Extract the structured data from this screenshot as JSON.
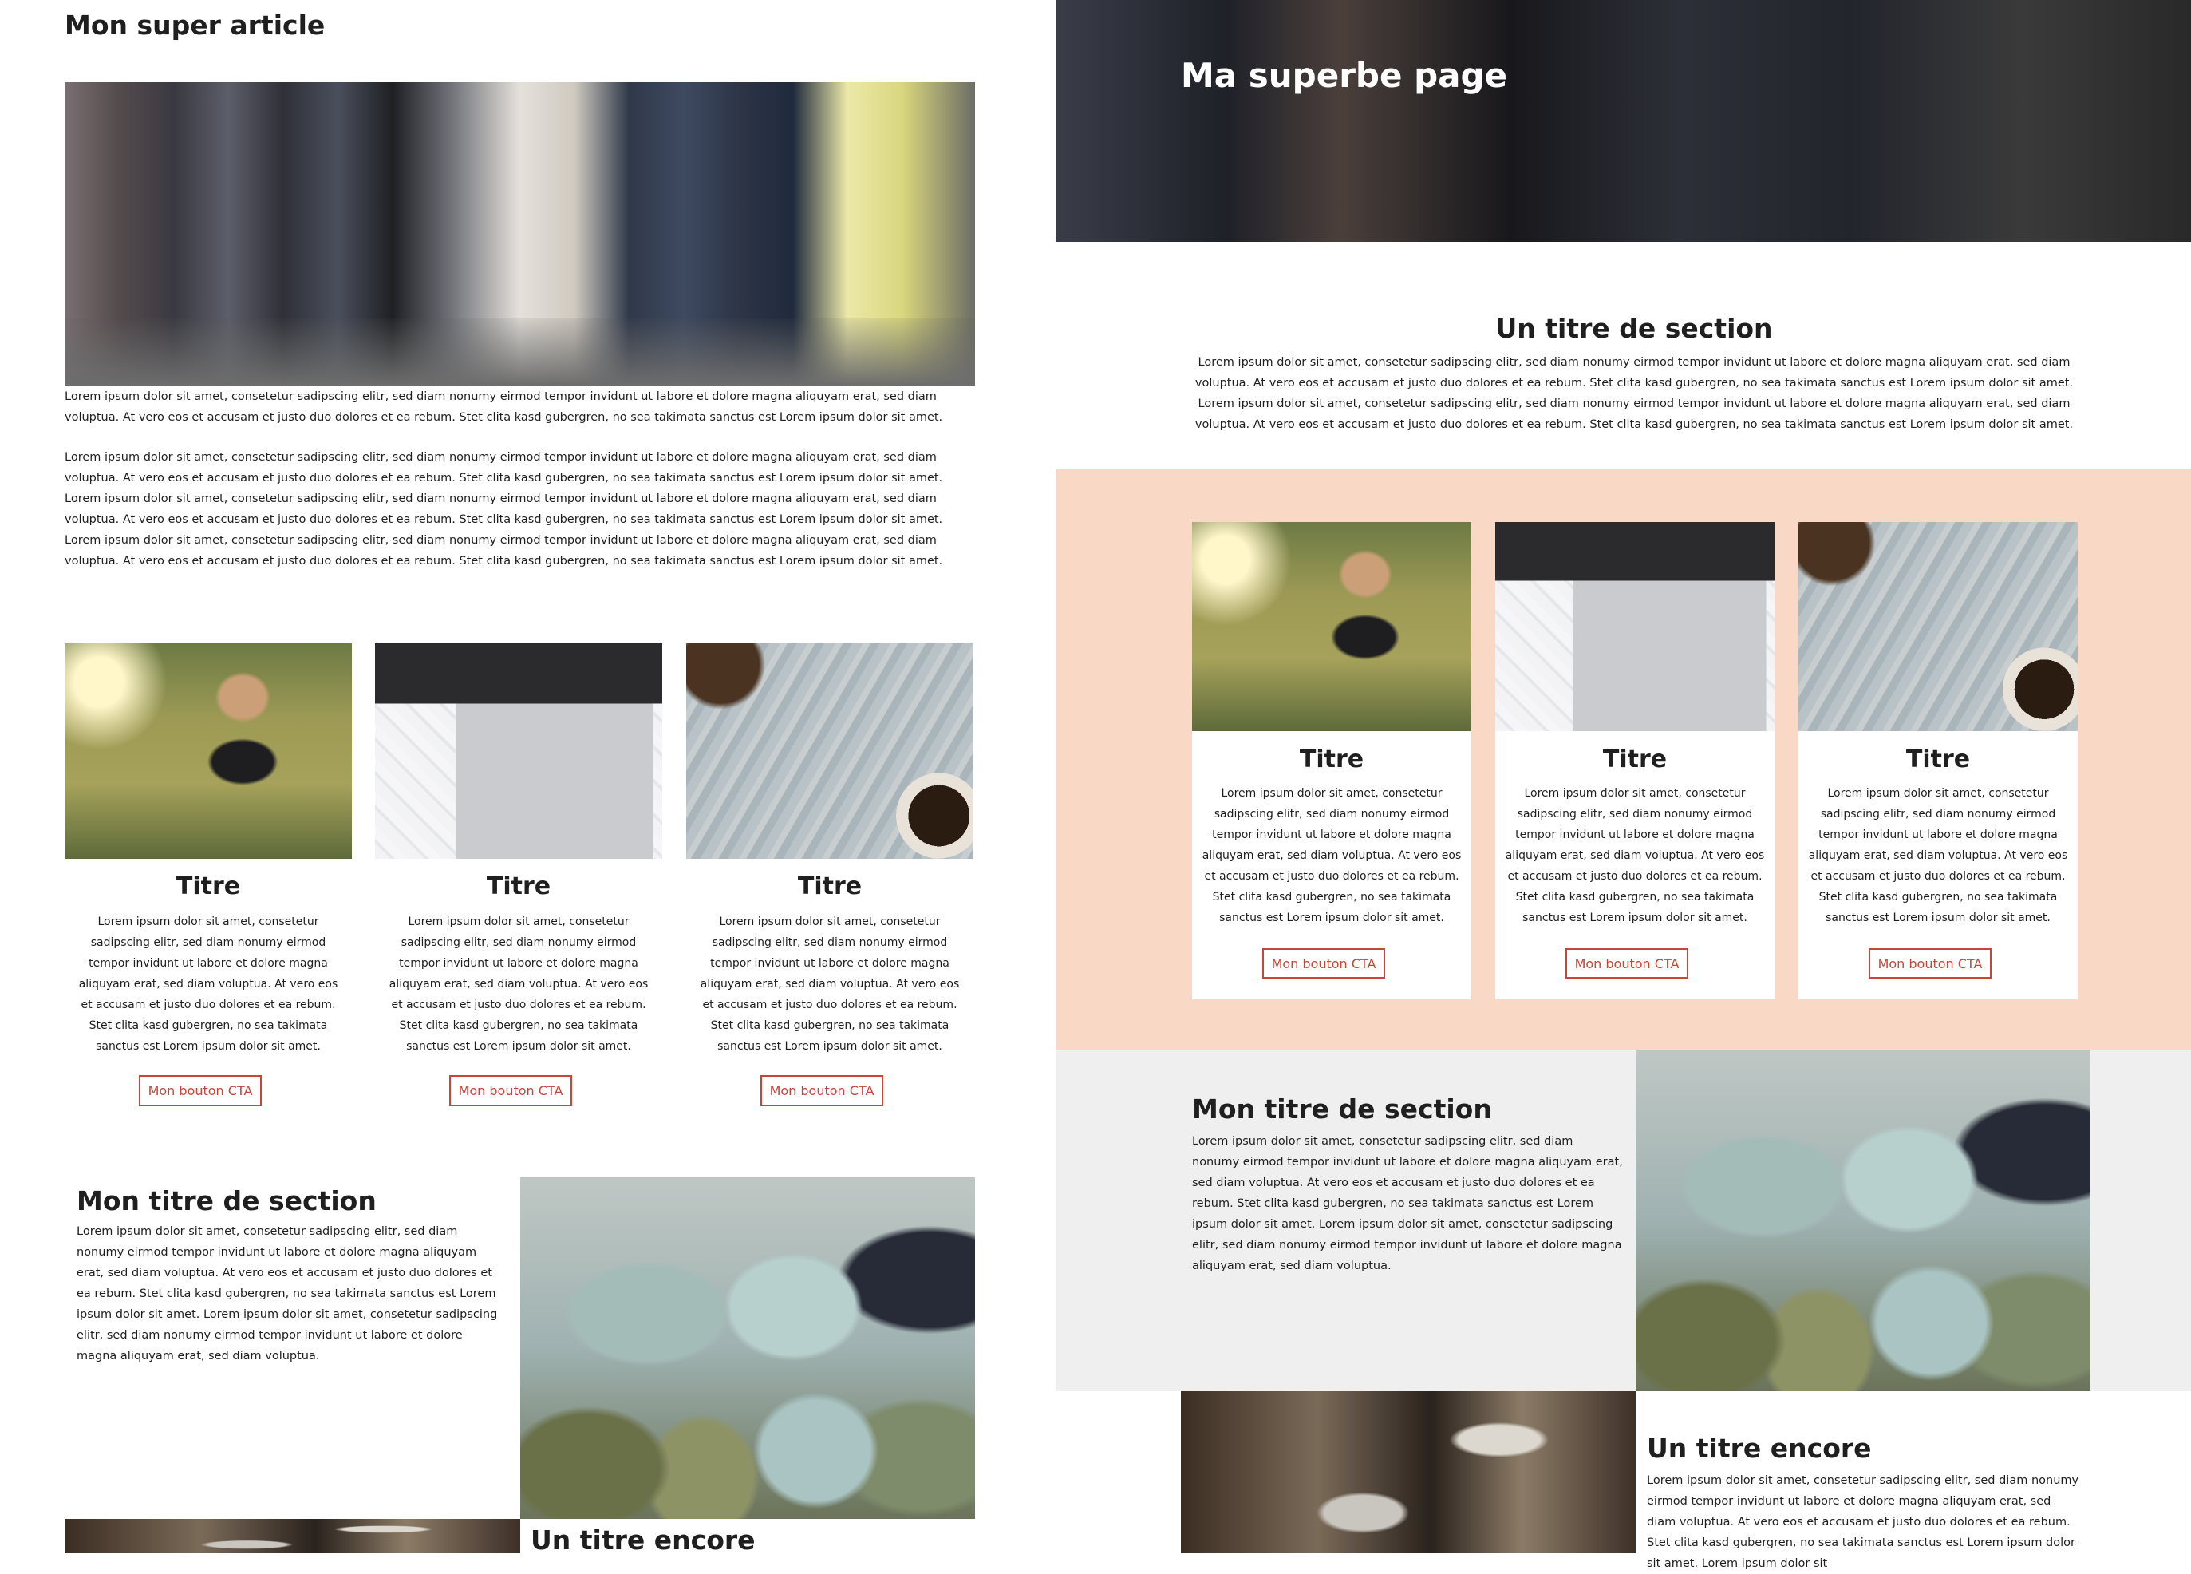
{
  "left": {
    "article_title": "Mon super article",
    "intro_short": "Lorem ipsum dolor sit amet, consetetur sadipscing elitr, sed diam nonumy eirmod tempor invidunt ut labore et dolore magna aliquyam erat, sed diam voluptua. At vero eos et accusam et justo duo dolores et ea rebum. Stet clita kasd gubergren, no sea takimata sanctus est Lorem ipsum dolor sit amet.",
    "intro_long": "Lorem ipsum dolor sit amet, consetetur sadipscing elitr, sed diam nonumy eirmod tempor invidunt ut labore et dolore magna aliquyam erat, sed diam voluptua. At vero eos et accusam et justo duo dolores et ea rebum. Stet clita kasd gubergren, no sea takimata sanctus est Lorem ipsum dolor sit amet. Lorem ipsum dolor sit amet, consetetur sadipscing elitr, sed diam nonumy eirmod tempor invidunt ut labore et dolore magna aliquyam erat, sed diam voluptua. At vero eos et accusam et justo duo dolores et ea rebum. Stet clita kasd gubergren, no sea takimata sanctus est Lorem ipsum dolor sit amet. Lorem ipsum dolor sit amet, consetetur sadipscing elitr, sed diam nonumy eirmod tempor invidunt ut labore et dolore magna aliquyam erat, sed diam voluptua. At vero eos et accusam et justo duo dolores et ea rebum. Stet clita kasd gubergren, no sea takimata sanctus est Lorem ipsum dolor sit amet.",
    "cards": [
      {
        "title": "Titre",
        "text": "Lorem ipsum dolor sit amet, consetetur sadipscing elitr, sed diam nonumy eirmod tempor invidunt ut labore et dolore magna aliquyam erat, sed diam voluptua. At vero eos et accusam et justo duo dolores et ea rebum. Stet clita kasd gubergren, no sea takimata sanctus est Lorem ipsum dolor sit amet.",
        "cta": "Mon bouton CTA"
      },
      {
        "title": "Titre",
        "text": "Lorem ipsum dolor sit amet, consetetur sadipscing elitr, sed diam nonumy eirmod tempor invidunt ut labore et dolore magna aliquyam erat, sed diam voluptua. At vero eos et accusam et justo duo dolores et ea rebum. Stet clita kasd gubergren, no sea takimata sanctus est Lorem ipsum dolor sit amet.",
        "cta": "Mon bouton CTA"
      },
      {
        "title": "Titre",
        "text": "Lorem ipsum dolor sit amet, consetetur sadipscing elitr, sed diam nonumy eirmod tempor invidunt ut labore et dolore magna aliquyam erat, sed diam voluptua. At vero eos et accusam et justo duo dolores et ea rebum. Stet clita kasd gubergren, no sea takimata sanctus est Lorem ipsum dolor sit amet.",
        "cta": "Mon bouton CTA"
      }
    ],
    "section_title": "Mon titre de section",
    "section_text": "Lorem ipsum dolor sit amet, consetetur sadipscing elitr, sed diam nonumy eirmod tempor invidunt ut labore et dolore magna aliquyam erat, sed diam voluptua. At vero eos et accusam et justo duo dolores et ea rebum. Stet clita kasd gubergren, no sea takimata sanctus est Lorem ipsum dolor sit amet. Lorem ipsum dolor sit amet, consetetur sadipscing elitr, sed diam nonumy eirmod tempor invidunt ut labore et dolore magna aliquyam erat, sed diam voluptua.",
    "title_encore": "Un titre encore"
  },
  "right": {
    "hero_title": "Ma superbe page",
    "section_heading": "Un titre de section",
    "section_intro": "Lorem ipsum dolor sit amet, consetetur sadipscing elitr, sed diam nonumy eirmod tempor invidunt ut labore et dolore magna aliquyam erat, sed diam voluptua. At vero eos et accusam et justo duo dolores et ea rebum. Stet clita kasd gubergren, no sea takimata sanctus est Lorem ipsum dolor sit amet. Lorem ipsum dolor sit amet, consetetur sadipscing elitr, sed diam nonumy eirmod tempor invidunt ut labore et dolore magna aliquyam erat, sed diam voluptua. At vero eos et accusam et justo duo dolores et ea rebum. Stet clita kasd gubergren, no sea takimata sanctus est Lorem ipsum dolor sit amet.",
    "cards": [
      {
        "title": "Titre",
        "text": "Lorem ipsum dolor sit amet, consetetur sadipscing elitr, sed diam nonumy eirmod tempor invidunt ut labore et dolore magna aliquyam erat, sed diam voluptua. At vero eos et accusam et justo duo dolores et ea rebum. Stet clita kasd gubergren, no sea takimata sanctus est Lorem ipsum dolor sit amet.",
        "cta": "Mon bouton CTA"
      },
      {
        "title": "Titre",
        "text": "Lorem ipsum dolor sit amet, consetetur sadipscing elitr, sed diam nonumy eirmod tempor invidunt ut labore et dolore magna aliquyam erat, sed diam voluptua. At vero eos et accusam et justo duo dolores et ea rebum. Stet clita kasd gubergren, no sea takimata sanctus est Lorem ipsum dolor sit amet.",
        "cta": "Mon bouton CTA"
      },
      {
        "title": "Titre",
        "text": "Lorem ipsum dolor sit amet, consetetur sadipscing elitr, sed diam nonumy eirmod tempor invidunt ut labore et dolore magna aliquyam erat, sed diam voluptua. At vero eos et accusam et justo duo dolores et ea rebum. Stet clita kasd gubergren, no sea takimata sanctus est Lorem ipsum dolor sit amet.",
        "cta": "Mon bouton CTA"
      }
    ],
    "section_title": "Mon titre de section",
    "section_text": "Lorem ipsum dolor sit amet, consetetur sadipscing elitr, sed diam nonumy eirmod tempor invidunt ut labore et dolore magna aliquyam erat, sed diam voluptua. At vero eos et accusam et justo duo dolores et ea rebum. Stet clita kasd gubergren, no sea takimata sanctus est Lorem ipsum dolor sit amet. Lorem ipsum dolor sit amet, consetetur sadipscing elitr, sed diam nonumy eirmod tempor invidunt ut labore et dolore magna aliquyam erat, sed diam voluptua.",
    "title_encore": "Un titre encore",
    "encore_text": "Lorem ipsum dolor sit amet, consetetur sadipscing elitr, sed diam nonumy eirmod tempor invidunt ut labore et dolore magna aliquyam erat, sed diam voluptua. At vero eos et accusam et justo duo dolores et ea rebum. Stet clita kasd gubergren, no sea takimata sanctus est Lorem ipsum dolor sit amet. Lorem ipsum dolor sit"
  },
  "colors": {
    "accent": "#c8453a",
    "peach_band": "#f9d9c6",
    "grey_band": "#efefef",
    "text": "#1f1f1f"
  }
}
